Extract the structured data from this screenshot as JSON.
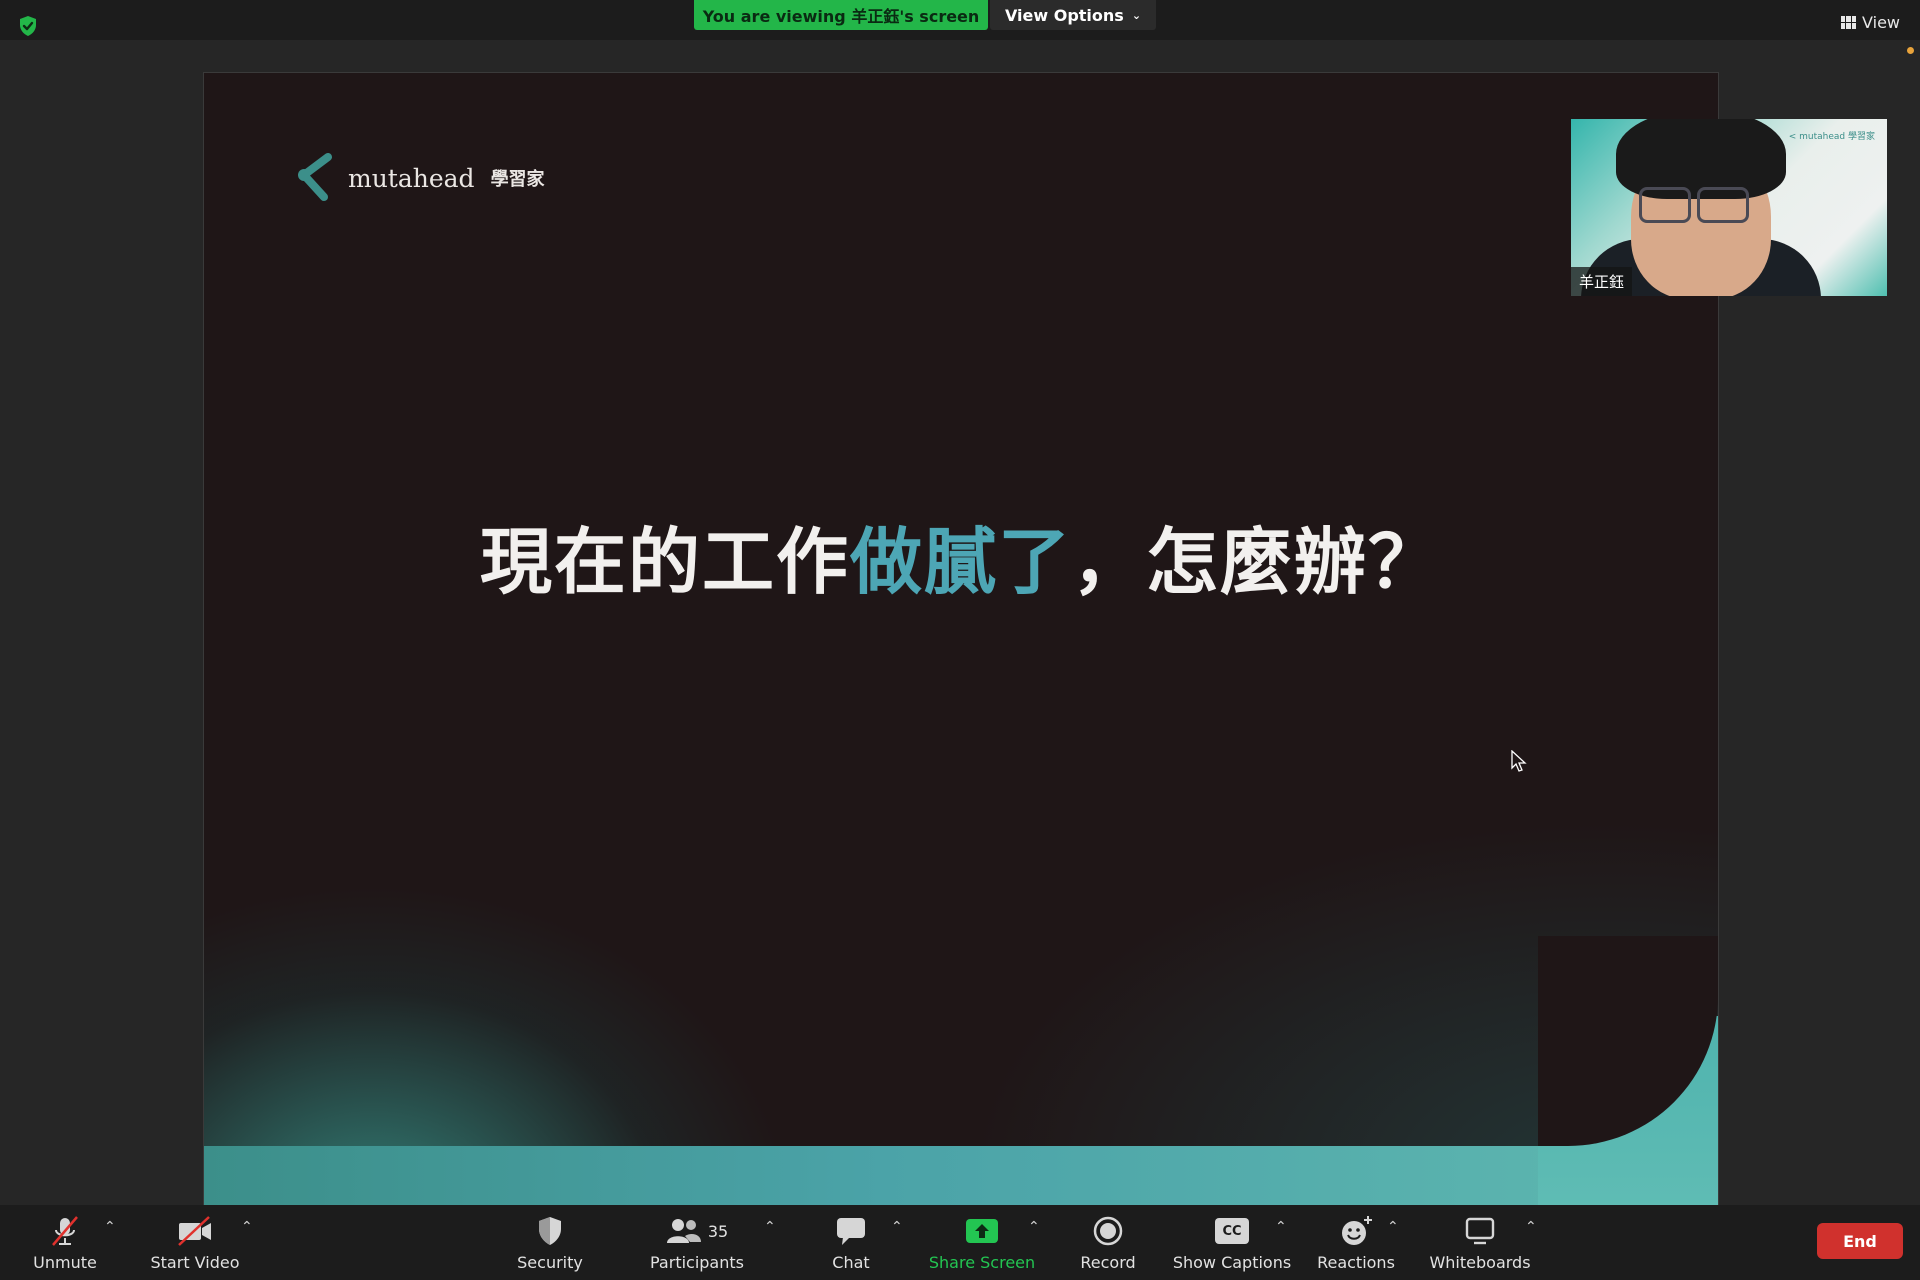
{
  "top_bar": {
    "viewing_banner": "You are viewing 羊正鈺's screen",
    "view_options_label": "View Options",
    "view_label": "View"
  },
  "slide": {
    "brand_name": "mutahead",
    "brand_cn": "學習家",
    "headline_part1": "現在的工作",
    "headline_highlight": "做膩了",
    "headline_part2": "，怎麼辦？"
  },
  "speaker": {
    "name": "羊正鈺",
    "mini_logo": "< mutahead 學習家"
  },
  "toolbar": {
    "unmute": "Unmute",
    "start_video": "Start Video",
    "security": "Security",
    "participants": "Participants",
    "participants_count": "35",
    "chat": "Chat",
    "share_screen": "Share Screen",
    "record": "Record",
    "show_captions": "Show Captions",
    "cc_badge": "CC",
    "reactions": "Reactions",
    "whiteboards": "Whiteboards",
    "end": "End"
  },
  "colors": {
    "banner_green": "#23b649",
    "headline_highlight": "#4da6b5",
    "end_red": "#d0312d",
    "share_green": "#23c552"
  }
}
